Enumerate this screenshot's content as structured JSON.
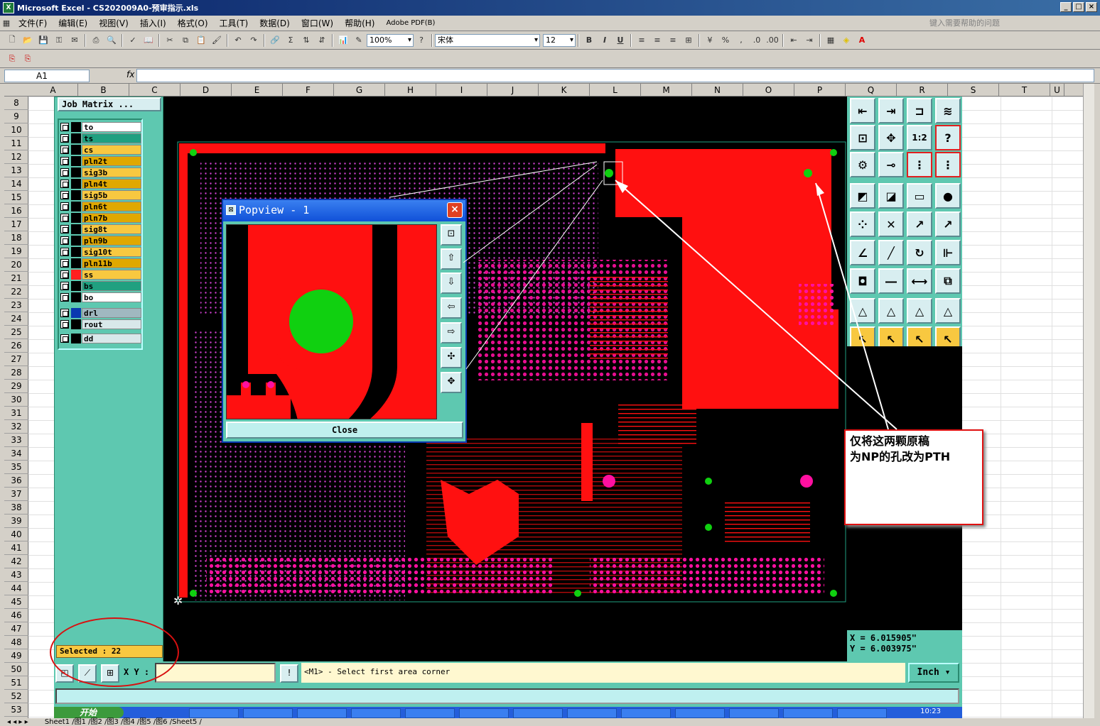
{
  "window": {
    "title": "Microsoft Excel - CS202009A0-预审指示.xls"
  },
  "menu": {
    "items": [
      "文件(F)",
      "编辑(E)",
      "视图(V)",
      "插入(I)",
      "格式(O)",
      "工具(T)",
      "数据(D)",
      "窗口(W)",
      "帮助(H)",
      "Adobe PDF(B)"
    ],
    "help_placeholder": "键入需要帮助的问题"
  },
  "toolbar": {
    "zoom": "100%",
    "font": "宋体",
    "size": "12",
    "bold": "B",
    "italic": "I",
    "underline": "U"
  },
  "formula": {
    "cell_ref": "A1",
    "fx": "fx"
  },
  "columns": [
    "A",
    "B",
    "C",
    "D",
    "E",
    "F",
    "G",
    "H",
    "I",
    "J",
    "K",
    "L",
    "M",
    "N",
    "O",
    "P",
    "Q",
    "R",
    "S",
    "T",
    "U"
  ],
  "rows": [
    "8",
    "9",
    "10",
    "11",
    "12",
    "13",
    "14",
    "15",
    "16",
    "17",
    "18",
    "19",
    "20",
    "21",
    "22",
    "23",
    "24",
    "25",
    "26",
    "27",
    "28",
    "29",
    "30",
    "31",
    "32",
    "33",
    "34",
    "35",
    "36",
    "37",
    "38",
    "39",
    "40",
    "41",
    "42",
    "43",
    "44",
    "45",
    "46",
    "47",
    "48",
    "49",
    "50",
    "51",
    "52",
    "53"
  ],
  "job_matrix": {
    "title": "Job Matrix ...",
    "layers": [
      {
        "name": "to",
        "bg": "#ffffff",
        "swatch": "#000000"
      },
      {
        "name": "ts",
        "bg": "#20a080",
        "swatch": "#000000"
      },
      {
        "name": "cs",
        "bg": "#f8c840",
        "swatch": "#000000"
      },
      {
        "name": "pln2t",
        "bg": "#e0a800",
        "swatch": "#000000"
      },
      {
        "name": "sig3b",
        "bg": "#f8c840",
        "swatch": "#000000"
      },
      {
        "name": "pln4t",
        "bg": "#e0a800",
        "swatch": "#000000"
      },
      {
        "name": "sig5b",
        "bg": "#f8c840",
        "swatch": "#000000"
      },
      {
        "name": "pln6t",
        "bg": "#e0a800",
        "swatch": "#000000"
      },
      {
        "name": "pln7b",
        "bg": "#e0a800",
        "swatch": "#000000"
      },
      {
        "name": "sig8t",
        "bg": "#f8c840",
        "swatch": "#000000"
      },
      {
        "name": "pln9b",
        "bg": "#e0a800",
        "swatch": "#000000"
      },
      {
        "name": "sig10t",
        "bg": "#f8c840",
        "swatch": "#000000"
      },
      {
        "name": "pln11b",
        "bg": "#e0a800",
        "swatch": "#000000"
      },
      {
        "name": "ss",
        "bg": "#f8c840",
        "swatch": "#ff2020"
      },
      {
        "name": "bs",
        "bg": "#20a080",
        "swatch": "#000000"
      },
      {
        "name": "bo",
        "bg": "#ffffff",
        "swatch": "#000000"
      },
      {
        "name": "drl",
        "bg": "#a0b8c0",
        "swatch": "#0a3ab0"
      },
      {
        "name": "rout",
        "bg": "#d8e8ea",
        "swatch": "#000000"
      },
      {
        "name": "dd",
        "bg": "#d8e8ea",
        "swatch": "#000000"
      }
    ],
    "selected": "Selected : 22"
  },
  "popview": {
    "title": "Popview - 1",
    "close_label": "Close",
    "close_x": "×"
  },
  "coords": {
    "x": "X = 6.015905\"",
    "y": "Y = 6.003975\""
  },
  "status": {
    "xy_label": "X Y :",
    "message": "<M1> - Select first area corner",
    "unit": "Inch",
    "alert": "!"
  },
  "annotation": {
    "line1": "仅将这两颗原稿",
    "line2": "为NP的孔改为PTH"
  },
  "taskbar": {
    "start": "开始",
    "clock": "10:23"
  },
  "sheet_tabs": "Sheet1 /图1 /图2 /图3 /图4 /图5 /图6 /Sheet5 /",
  "colors": {
    "pcb_copper": "#ff1010",
    "pad": "#ff10a0",
    "hole": "#10d010",
    "panel": "#5ec8b0"
  }
}
